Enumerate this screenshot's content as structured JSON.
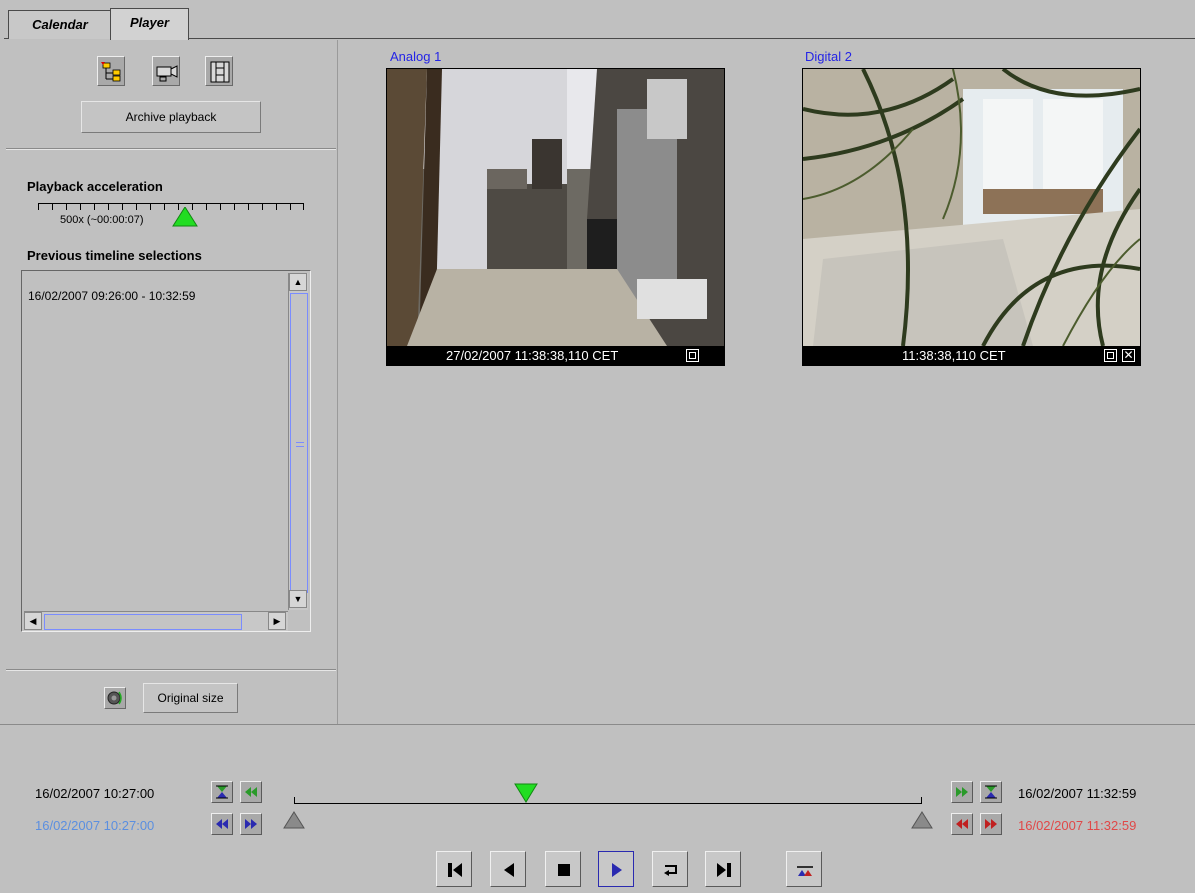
{
  "tabs": [
    {
      "label": "Calendar"
    },
    {
      "label": "Player"
    }
  ],
  "left_panel": {
    "archive_button": "Archive playback",
    "playback_acceleration_label": "Playback acceleration",
    "acceleration_value": "500x (~00:00:07)",
    "previous_selections_label": "Previous timeline selections",
    "previous_selections": [
      "16/02/2007 09:26:00 - 10:32:59"
    ],
    "original_size_button": "Original size"
  },
  "cameras": [
    {
      "title": "Analog 1",
      "timestamp": "27/02/2007 11:38:38,110 CET",
      "icons": [
        "maximize-icon"
      ]
    },
    {
      "title": "Digital 2",
      "timestamp": "11:38:38,110 CET",
      "icons": [
        "maximize-icon",
        "close-icon"
      ]
    }
  ],
  "timeline": {
    "start_date": "16/02/2007 10:27:00",
    "start_date_selected": "16/02/2007 10:27:00",
    "end_date": "16/02/2007 11:32:59",
    "end_date_selected": "16/02/2007 11:32:59",
    "start_selected_color": "#5b8fe0",
    "end_selected_color": "#e04848",
    "cursor_color": "#22cc22"
  },
  "playback_controls": [
    "skip-to-start-icon",
    "step-back-icon",
    "stop-icon",
    "play-icon",
    "loop-icon",
    "skip-to-end-icon",
    "timeline-range-icon"
  ]
}
